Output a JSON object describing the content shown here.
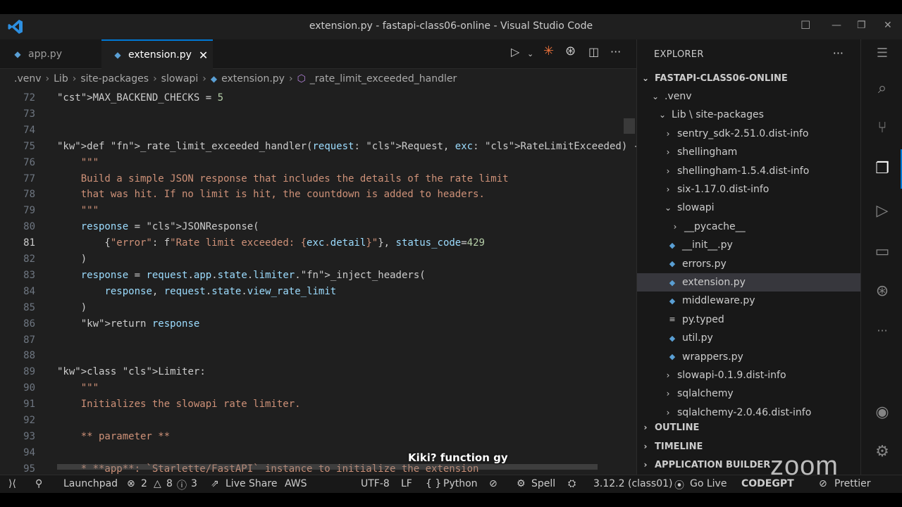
{
  "window": {
    "title": "extension.py - fastapi-class06-online - Visual Studio Code"
  },
  "tabs": [
    {
      "label": "app.py",
      "active": false
    },
    {
      "label": "extension.py",
      "active": true
    }
  ],
  "breadcrumb": [
    ".venv",
    "Lib",
    "site-packages",
    "slowapi",
    "extension.py",
    "_rate_limit_exceeded_handler"
  ],
  "editor": {
    "current_line": "81",
    "lines": [
      {
        "n": "72",
        "text": "MAX_BACKEND_CHECKS = 5"
      },
      {
        "n": "73",
        "text": ""
      },
      {
        "n": "74",
        "text": ""
      },
      {
        "n": "75",
        "text": "def _rate_limit_exceeded_handler(request: Request, exc: RateLimitExceeded) -> Response:"
      },
      {
        "n": "76",
        "text": "    \"\"\""
      },
      {
        "n": "77",
        "text": "    Build a simple JSON response that includes the details of the rate limit"
      },
      {
        "n": "78",
        "text": "    that was hit. If no limit is hit, the countdown is added to headers."
      },
      {
        "n": "79",
        "text": "    \"\"\""
      },
      {
        "n": "80",
        "text": "    response = JSONResponse("
      },
      {
        "n": "81",
        "text": "        {\"error\": f\"Rate limit exceeded: {exc.detail}\"}, status_code=429"
      },
      {
        "n": "82",
        "text": "    )"
      },
      {
        "n": "83",
        "text": "    response = request.app.state.limiter._inject_headers("
      },
      {
        "n": "84",
        "text": "        response, request.state.view_rate_limit"
      },
      {
        "n": "85",
        "text": "    )"
      },
      {
        "n": "86",
        "text": "    return response"
      },
      {
        "n": "87",
        "text": ""
      },
      {
        "n": "88",
        "text": ""
      },
      {
        "n": "89",
        "text": "class Limiter:"
      },
      {
        "n": "90",
        "text": "    \"\"\""
      },
      {
        "n": "91",
        "text": "    Initializes the slowapi rate limiter."
      },
      {
        "n": "92",
        "text": ""
      },
      {
        "n": "93",
        "text": "    ** parameter **"
      },
      {
        "n": "94",
        "text": ""
      },
      {
        "n": "95",
        "text": "    * **app**: `Starlette/FastAPI` instance to initialize the extension"
      }
    ]
  },
  "explorer": {
    "header": "EXPLORER",
    "root": "FASTAPI-CLASS06-ONLINE",
    "items": [
      {
        "label": ".venv",
        "kind": "folder-open"
      },
      {
        "label": "Lib \\ site-packages",
        "kind": "folder-open"
      },
      {
        "label": "sentry_sdk-2.51.0.dist-info",
        "kind": "folder"
      },
      {
        "label": "shellingham",
        "kind": "folder"
      },
      {
        "label": "shellingham-1.5.4.dist-info",
        "kind": "folder"
      },
      {
        "label": "six-1.17.0.dist-info",
        "kind": "folder"
      },
      {
        "label": "slowapi",
        "kind": "folder-open"
      },
      {
        "label": "__pycache__",
        "kind": "folder"
      },
      {
        "label": "__init__.py",
        "kind": "py"
      },
      {
        "label": "errors.py",
        "kind": "py"
      },
      {
        "label": "extension.py",
        "kind": "py"
      },
      {
        "label": "middleware.py",
        "kind": "py"
      },
      {
        "label": "py.typed",
        "kind": "file"
      },
      {
        "label": "util.py",
        "kind": "py"
      },
      {
        "label": "wrappers.py",
        "kind": "py"
      },
      {
        "label": "slowapi-0.1.9.dist-info",
        "kind": "folder"
      },
      {
        "label": "sqlalchemy",
        "kind": "folder"
      },
      {
        "label": "sqlalchemy-2.0.46.dist-info",
        "kind": "folder"
      }
    ],
    "sections": [
      "OUTLINE",
      "TIMELINE",
      "APPLICATION BUILDER"
    ]
  },
  "statusbar": {
    "remote": "⟩⟨",
    "launchpad": "Launchpad",
    "errors": "2",
    "warnings": "8",
    "info": "3",
    "live_share": "Live Share",
    "aws": "AWS",
    "encoding": "UTF-8",
    "eol": "LF",
    "language": "Python",
    "spell": "Spell",
    "python_version": "3.12.2 (class01)",
    "go_live": "Go Live",
    "codegpt": "CODEGPT",
    "prettier": "Prettier"
  },
  "overlay": {
    "caption": "Kiki? function gy",
    "zoom_logo": "zoom"
  },
  "colors": {
    "accent": "#0078d4",
    "background": "#1f1f1f",
    "sidebar": "#181818"
  }
}
